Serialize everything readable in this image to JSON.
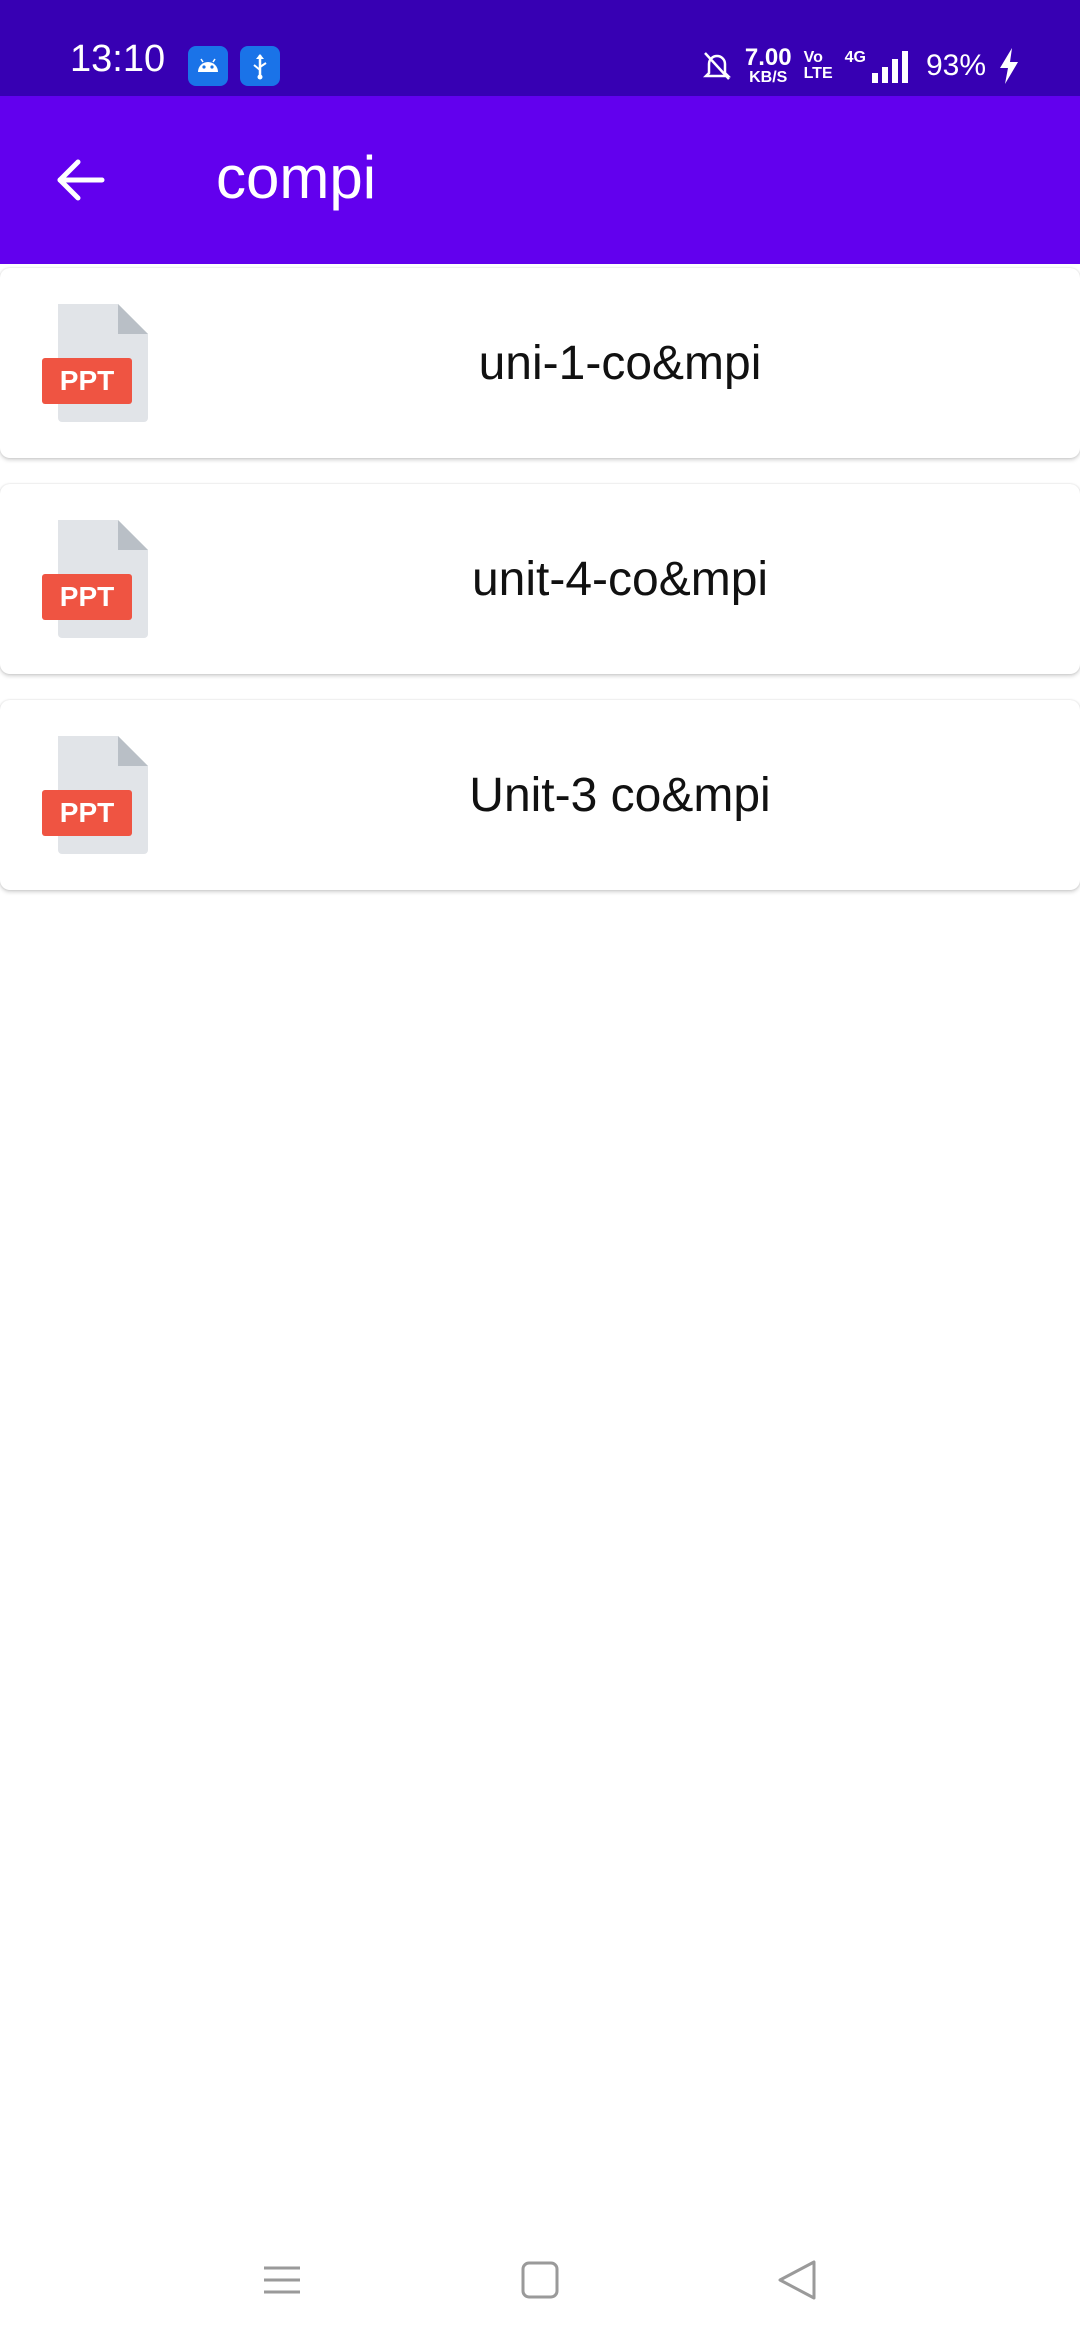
{
  "status_bar": {
    "time": "13:10",
    "speed_value": "7.00",
    "speed_unit": "KB/S",
    "volte_top": "Vo",
    "volte_bottom": "LTE",
    "network": "4G",
    "battery": "93%",
    "icons": [
      "android-icon",
      "usb-icon",
      "mute-bell-icon",
      "signal-icon",
      "charging-bolt-icon"
    ]
  },
  "app_bar": {
    "title": "compi",
    "back_icon": "arrow-back-icon",
    "color": "#6200ee"
  },
  "files": [
    {
      "name": "uni-1-co&mpi",
      "type_badge": "PPT"
    },
    {
      "name": "unit-4-co&mpi",
      "type_badge": "PPT"
    },
    {
      "name": "Unit-3 co&mpi",
      "type_badge": "PPT"
    }
  ],
  "colors": {
    "status_bar": "#3700b3",
    "app_bar": "#6200ee",
    "ppt_badge": "#ef5442"
  },
  "nav_bar": {
    "icons": [
      "recent-apps-icon",
      "home-icon",
      "back-triangle-icon"
    ]
  }
}
